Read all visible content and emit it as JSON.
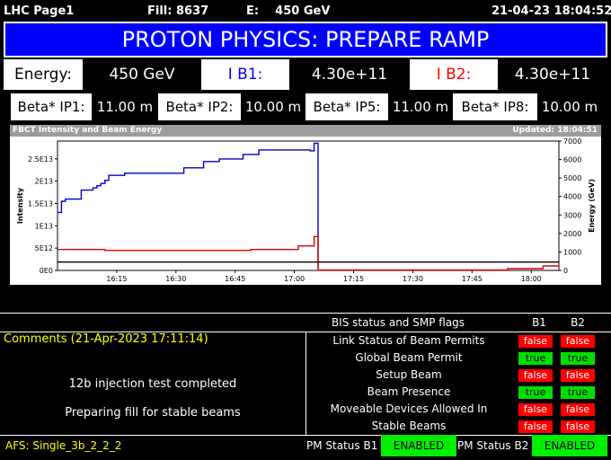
{
  "topbar": {
    "page": "LHC Page1",
    "fill": "Fill: 8637",
    "energy": "E:    450 GeV",
    "timestamp": "21-04-23 18:04:52"
  },
  "banner": {
    "title": "PROTON PHYSICS: PREPARE RAMP"
  },
  "energy_row": {
    "energy_label": "Energy:",
    "energy_value": "450 GeV",
    "ib1_label": "I B1:",
    "ib1_value": "4.30e+11",
    "ib2_label": "I B2:",
    "ib2_value": "4.30e+11"
  },
  "beta_row": [
    {
      "label": "Beta* IP1:",
      "value": "11.00 m"
    },
    {
      "label": "Beta* IP2:",
      "value": "10.00 m"
    },
    {
      "label": "Beta* IP5:",
      "value": "11.00 m"
    },
    {
      "label": "Beta* IP8:",
      "value": "10.00 m"
    }
  ],
  "chart": {
    "title": "FBCT Intensity and Beam Energy",
    "updated": "Updated: 18:04:51"
  },
  "chart_data": {
    "type": "line",
    "title": "FBCT Intensity and Beam Energy",
    "xlabel": "",
    "ylabel": "Intensity",
    "y2label": "Energy (GeV)",
    "x_ticks": [
      "16:15",
      "16:30",
      "16:45",
      "17:00",
      "17:15",
      "17:30",
      "17:45",
      "18:00"
    ],
    "y_ticks": [
      "0E0",
      "5E12",
      "1E13",
      "1.5E13",
      "2E13",
      "2.5E13"
    ],
    "y2_ticks": [
      "0",
      "1000",
      "2000",
      "3000",
      "4000",
      "5000",
      "6000",
      "7000"
    ],
    "xlim": [
      "16:00",
      "18:07"
    ],
    "ylim": [
      0,
      29000000000000.0
    ],
    "y2lim": [
      0,
      7000
    ],
    "series": [
      {
        "color": "#0000cc",
        "axis": "left",
        "x": [
          "16:00",
          "16:01",
          "16:01",
          "16:02",
          "16:02",
          "16:06",
          "16:06",
          "16:09",
          "16:09",
          "16:10",
          "16:10",
          "16:11",
          "16:11",
          "16:12",
          "16:12",
          "16:13",
          "16:13",
          "16:17",
          "16:17",
          "16:32",
          "16:32",
          "16:37",
          "16:37",
          "16:41",
          "16:41",
          "16:47",
          "16:47",
          "16:51",
          "16:51",
          "17:04",
          "17:04",
          "17:05",
          "17:05",
          "17:06",
          "17:06"
        ],
        "values": [
          13000000000000.0,
          13000000000000.0,
          15500000000000.0,
          15500000000000.0,
          16000000000000.0,
          16000000000000.0,
          18000000000000.0,
          18000000000000.0,
          18500000000000.0,
          18500000000000.0,
          19000000000000.0,
          19000000000000.0,
          19500000000000.0,
          19500000000000.0,
          20200000000000.0,
          20200000000000.0,
          21300000000000.0,
          21300000000000.0,
          21800000000000.0,
          21800000000000.0,
          23000000000000.0,
          23000000000000.0,
          24400000000000.0,
          24400000000000.0,
          25000000000000.0,
          25000000000000.0,
          26000000000000.0,
          26000000000000.0,
          27000000000000.0,
          27000000000000.0,
          26800000000000.0,
          26800000000000.0,
          28500000000000.0,
          28500000000000.0,
          500000000000.0
        ]
      },
      {
        "color": "#dd0000",
        "axis": "left",
        "x": [
          "16:00",
          "16:12",
          "16:12",
          "16:49",
          "16:49",
          "17:01",
          "17:01",
          "17:05",
          "17:05",
          "17:06",
          "17:06",
          "17:54",
          "17:54",
          "18:03",
          "18:03",
          "18:07"
        ],
        "values": [
          4700000000000.0,
          4700000000000.0,
          4500000000000.0,
          4500000000000.0,
          4700000000000.0,
          4700000000000.0,
          5500000000000.0,
          5500000000000.0,
          7600000000000.0,
          7600000000000.0,
          100000000000.0,
          100000000000.0,
          400000000000.0,
          400000000000.0,
          1000000000000.0,
          1000000000000.0
        ]
      },
      {
        "color": "#000000",
        "axis": "right",
        "x": [
          "16:00",
          "18:07"
        ],
        "values": [
          450,
          450
        ]
      }
    ]
  },
  "bis": {
    "title": "BIS status and SMP flags",
    "b1_header": "B1",
    "b2_header": "B2",
    "flags": [
      {
        "label": "Link Status of Beam Permits",
        "b1": "false",
        "b2": "false"
      },
      {
        "label": "Global Beam Permit",
        "b1": "true",
        "b2": "true"
      },
      {
        "label": "Setup Beam",
        "b1": "false",
        "b2": "false"
      },
      {
        "label": "Beam Presence",
        "b1": "true",
        "b2": "true"
      },
      {
        "label": "Moveable Devices Allowed In",
        "b1": "false",
        "b2": "false"
      },
      {
        "label": "Stable Beams",
        "b1": "false",
        "b2": "false"
      }
    ]
  },
  "comments": {
    "title": "Comments (21-Apr-2023 17:11:14)",
    "line1": "12b injection test completed",
    "line2": "Preparing fill for stable beams"
  },
  "footer": {
    "afs": "AFS: Single_3b_2_2_2",
    "pm_b1_label": "PM Status B1",
    "pm_b1_status": "ENABLED",
    "pm_b2_label": "PM Status B2",
    "pm_b2_status": "ENABLED"
  },
  "colors": {
    "banner": "#0000ff",
    "ib1": "#0000ff",
    "ib2": "#ff0000",
    "flag_true": "#00e000",
    "flag_false": "#ff0000",
    "enabled": "#00ee00",
    "comments": "#ffff00"
  }
}
